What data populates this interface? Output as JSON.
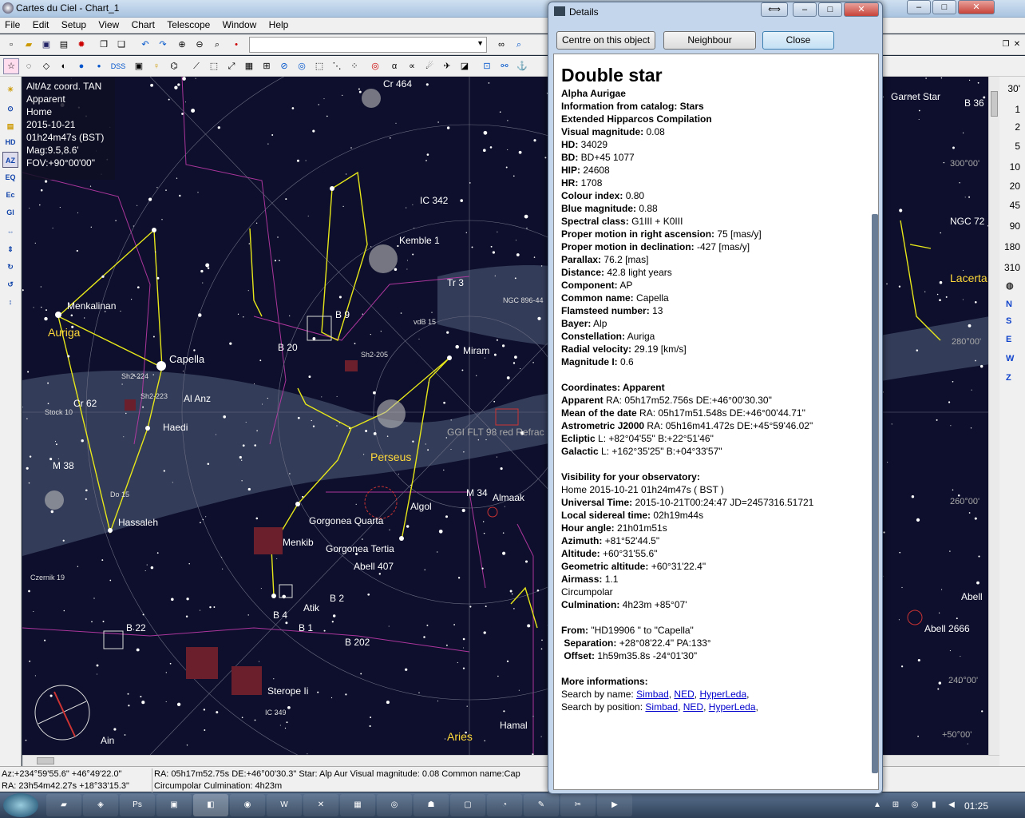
{
  "window": {
    "title": "Cartes du Ciel - Chart_1",
    "minimize": "–",
    "maximize": "□",
    "close": "✕"
  },
  "menu": [
    "File",
    "Edit",
    "Setup",
    "View",
    "Chart",
    "Telescope",
    "Window",
    "Help"
  ],
  "toolbar": {
    "dss_label": "DSS"
  },
  "chart_info": {
    "line1": "Alt/Az coord. TAN",
    "line2": "Apparent",
    "line3": "Home",
    "line4": "2015-10-21",
    "line5": "01h24m47s (BST)",
    "line6": "Mag:9.5,8.6'",
    "line7": "FOV:+90°00'00\""
  },
  "left_tools": [
    "HD",
    "AZ",
    "EQ",
    "Ec",
    "Gl"
  ],
  "fov_scale": [
    "30'",
    "1",
    "2",
    "5",
    "10",
    "20",
    "45",
    "90",
    "180",
    "310"
  ],
  "directions": [
    "N",
    "S",
    "E",
    "W",
    "Z"
  ],
  "chart_labels": {
    "capella": "Capella",
    "auriga": "Auriga",
    "perseus": "Perseus",
    "aries": "Aries",
    "lacerta": "Lacerta",
    "menkalinan": "Menkalinan",
    "hassaleh": "Hassaleh",
    "haedi": "Haedi",
    "al_anz": "Al Anz",
    "cr62": "Cr 62",
    "m38": "M 38",
    "m34": "M 34",
    "cr464": "Cr 464",
    "ic342": "IC 342",
    "kemble1": "Kemble 1",
    "tr3": "Tr 3",
    "b9": "B 9",
    "b20": "B 20",
    "miram": "Miram",
    "algol": "Algol",
    "almaak": "Almaak",
    "menkib": "Menkib",
    "gorgonea_quarta": "Gorgonea Quarta",
    "gorgonea_tertia": "Gorgonea Tertia",
    "abell407": "Abell 407",
    "atik": "Atik",
    "b2": "B 2",
    "b4": "B 4",
    "b1": "B 1",
    "b202": "B 202",
    "b22": "B 22",
    "sterope": "Sterope Ii",
    "hamal": "Hamal",
    "ain": "Ain",
    "garnet": "Garnet Star",
    "ngc72": "NGC 72",
    "abell2666": "Abell 2666",
    "abell": "Abell",
    "b36": "B 36",
    "flt": "GGI FLT 98 red Refrac",
    "sh2_224": "Sh2-224",
    "sh2_223": "Sh2-223",
    "sh2_205": "Sh2-205",
    "stock10": "Stock 10",
    "do15": "Do 15",
    "czernik19": "Czernik 19",
    "ic349": "IC 349",
    "ngc896": "NGC 896-44",
    "vdb15": "vdB 15",
    "az300": "300°00'",
    "az280": "280°00'",
    "az260": "260°00'",
    "az240": "240°00'",
    "alt50": "+50°00'"
  },
  "status": {
    "az_coord": "Az:+234°59'55.6\" +46°49'22.0\"",
    "ra_coord": "RA: 23h54m42.27s +18°33'15.3\"",
    "object_line1": "RA: 05h17m52.75s DE:+46°00'30.3\"  Star: Alp Aur  Visual magnitude:  0.08  Common name:Cap",
    "object_line2": "Circumpolar   Culmination:  4h23m"
  },
  "taskbar": {
    "clock": "01:25"
  },
  "details": {
    "title": "Details",
    "btn_centre": "Centre on this object",
    "btn_neighbour": "Neighbour",
    "btn_close": "Close",
    "heading": "Double star",
    "name": "Alpha Aurigae",
    "catalog_line": "Information from catalog: Stars",
    "catalog_name": "Extended Hipparcos Compilation",
    "fields": [
      {
        "label": "Visual magnitude:",
        "value": "0.08"
      },
      {
        "label": "HD:",
        "value": "34029"
      },
      {
        "label": "BD:",
        "value": "BD+45 1077"
      },
      {
        "label": "HIP:",
        "value": "24608"
      },
      {
        "label": "HR:",
        "value": "1708"
      },
      {
        "label": "Colour index:",
        "value": "0.80"
      },
      {
        "label": "Blue magnitude:",
        "value": "0.88"
      },
      {
        "label": "Spectral class:",
        "value": "G1III + K0III"
      },
      {
        "label": "Proper motion in right ascension:",
        "value": "75 [mas/y]"
      },
      {
        "label": "Proper motion in declination:",
        "value": "-427 [mas/y]"
      },
      {
        "label": "Parallax:",
        "value": "76.2 [mas]"
      },
      {
        "label": "Distance:",
        "value": "42.8 light years"
      },
      {
        "label": "Component:",
        "value": "AP"
      },
      {
        "label": "Common name:",
        "value": "Capella"
      },
      {
        "label": "Flamsteed number:",
        "value": "13"
      },
      {
        "label": "Bayer:",
        "value": "Alp"
      },
      {
        "label": "Constellation:",
        "value": "Auriga"
      },
      {
        "label": "Radial velocity:",
        "value": "29.19 [km/s]"
      },
      {
        "label": "Magnitude I:",
        "value": "0.6"
      }
    ],
    "coord_heading": "Coordinates: Apparent",
    "coords": [
      {
        "label": "Apparent",
        "value": "RA: 05h17m52.756s DE:+46°00'30.30\""
      },
      {
        "label": "Mean of the date",
        "value": "RA: 05h17m51.548s DE:+46°00'44.71\""
      },
      {
        "label": "Astrometric J2000",
        "value": "RA: 05h16m41.472s DE:+45°59'46.02\""
      },
      {
        "label": "Ecliptic",
        "value": " L: +82°04'55\" B:+22°51'46\""
      },
      {
        "label": "Galactic",
        "value": " L: +162°35'25\" B:+04°33'57\""
      }
    ],
    "vis_heading": "Visibility for your observatory:",
    "vis_location": "Home 2015-10-21 01h24m47s ( BST )",
    "visibility": [
      {
        "label": "Universal Time:",
        "value": "2015-10-21T00:24:47 JD=2457316.51721"
      },
      {
        "label": "Local sidereal time:",
        "value": "02h19m44s"
      },
      {
        "label": "Hour angle:",
        "value": "21h01m51s"
      },
      {
        "label": "Azimuth:",
        "value": "+81°52'44.5\""
      },
      {
        "label": "Altitude:",
        "value": "+60°31'55.6\""
      },
      {
        "label": "Geometric altitude:",
        "value": "+60°31'22.4\""
      },
      {
        "label": "Airmass:",
        "value": "1.1"
      }
    ],
    "circumpolar": "Circumpolar",
    "culmination_label": "Culmination:",
    "culmination_value": "4h23m +85°07'",
    "from_label": "From:",
    "from_value": "\"HD19906 \" to \"Capella\"",
    "separation_label": "Separation:",
    "separation_value": "+28°08'22.4\" PA:133°",
    "offset_label": "Offset:",
    "offset_value": "1h59m35.8s -24°01'30\"",
    "more_heading": "More informations:",
    "search_name_label": "Search by name:",
    "search_pos_label": "Search by position:",
    "link_simbad": "Simbad",
    "link_ned": "NED",
    "link_hyperleda": "HyperLeda"
  }
}
